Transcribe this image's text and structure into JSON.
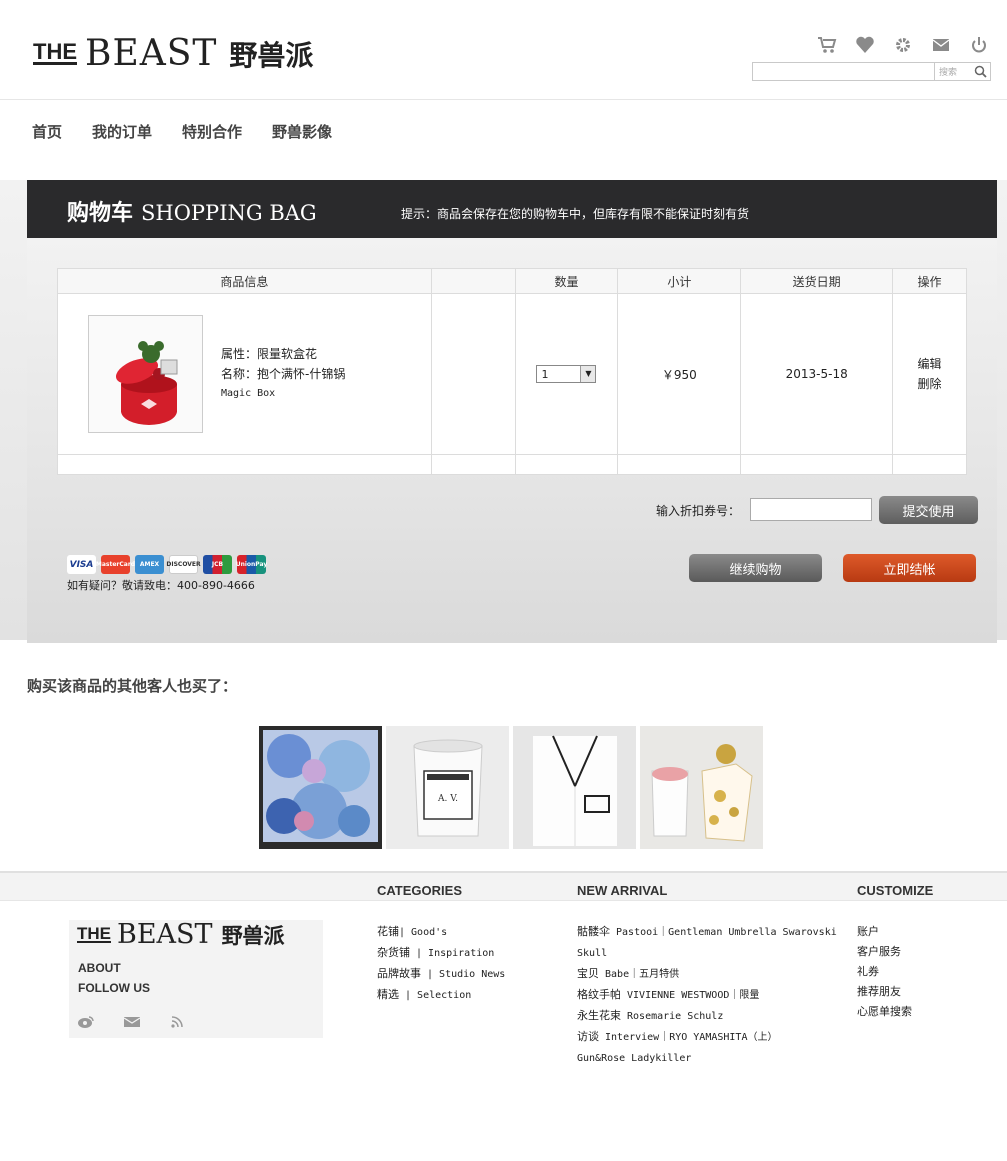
{
  "header": {
    "logo_the": "THE",
    "logo_beast": "BEAST",
    "logo_cn": "野兽派",
    "icons": [
      "cart-icon",
      "heart-icon",
      "gear-icon",
      "mail-icon",
      "power-icon"
    ],
    "search_placeholder": "",
    "search_button": "搜索"
  },
  "nav": [
    "首页",
    "我的订单",
    "特别合作",
    "野兽影像"
  ],
  "cart": {
    "title_cn": "购物车",
    "title_en": "SHOPPING BAG",
    "hint": "提示：商品会保存在您的购物车中，但库存有限不能保证时刻有货",
    "columns": [
      "商品信息",
      "",
      "数量",
      "小计",
      "送货日期",
      "操作"
    ],
    "item": {
      "attr": "属性：限量软盒花",
      "name": "名称：抱个满怀-什锦锅",
      "en_name": "Magic Box",
      "qty": "1",
      "subtotal": "￥950",
      "delivery": "2013-5-18",
      "edit": "编辑",
      "delete": "删除"
    },
    "coupon_label": "输入折扣券号：",
    "coupon_value": "",
    "submit_button": "提交使用",
    "continue_button": "继续购物",
    "checkout_button": "立即结帐",
    "cards": [
      "VISA",
      "MasterCard",
      "AMEX",
      "DISCOVER",
      "JCB",
      "UnionPay"
    ],
    "phone": "如有疑问？敬请致电：400-890-4666"
  },
  "also_bought": {
    "title": "购买该商品的其他客人也买了：",
    "items": [
      "scarf-product",
      "candle-product",
      "pajama-product",
      "gift-box-product"
    ]
  },
  "footer": {
    "categories_title": "CATEGORIES",
    "new_arrival_title": "NEW ARRIVAL",
    "customize_title": "CUSTOMIZE",
    "about": "ABOUT",
    "follow": "FOLLOW US",
    "categories": [
      {
        "cn": "花铺",
        "en": "| Good's"
      },
      {
        "cn": "杂货铺",
        "en": " | Inspiration"
      },
      {
        "cn": "品牌故事",
        "en": " | Studio News"
      },
      {
        "cn": "精选",
        "en": " | Selection"
      }
    ],
    "new_arrival": [
      {
        "cn": "骷髅伞",
        "en": " Pastooi｜Gentleman Umbrella Swarovski"
      },
      {
        "cn": "",
        "en": "Skull"
      },
      {
        "cn": "宝贝",
        "en": " Babe｜五月特供"
      },
      {
        "cn": "格纹手帕",
        "en": " VIVIENNE WESTWOOD｜限量"
      },
      {
        "cn": "永生花束",
        "en": " Rosemarie Schulz"
      },
      {
        "cn": "访谈",
        "en": " Interview｜RYO YAMASHITA（上）"
      },
      {
        "cn": "",
        "en": "Gun&Rose Ladykiller"
      }
    ],
    "customize": [
      "账户",
      "客户服务",
      "礼券",
      "推荐朋友",
      "心愿单搜索"
    ]
  }
}
